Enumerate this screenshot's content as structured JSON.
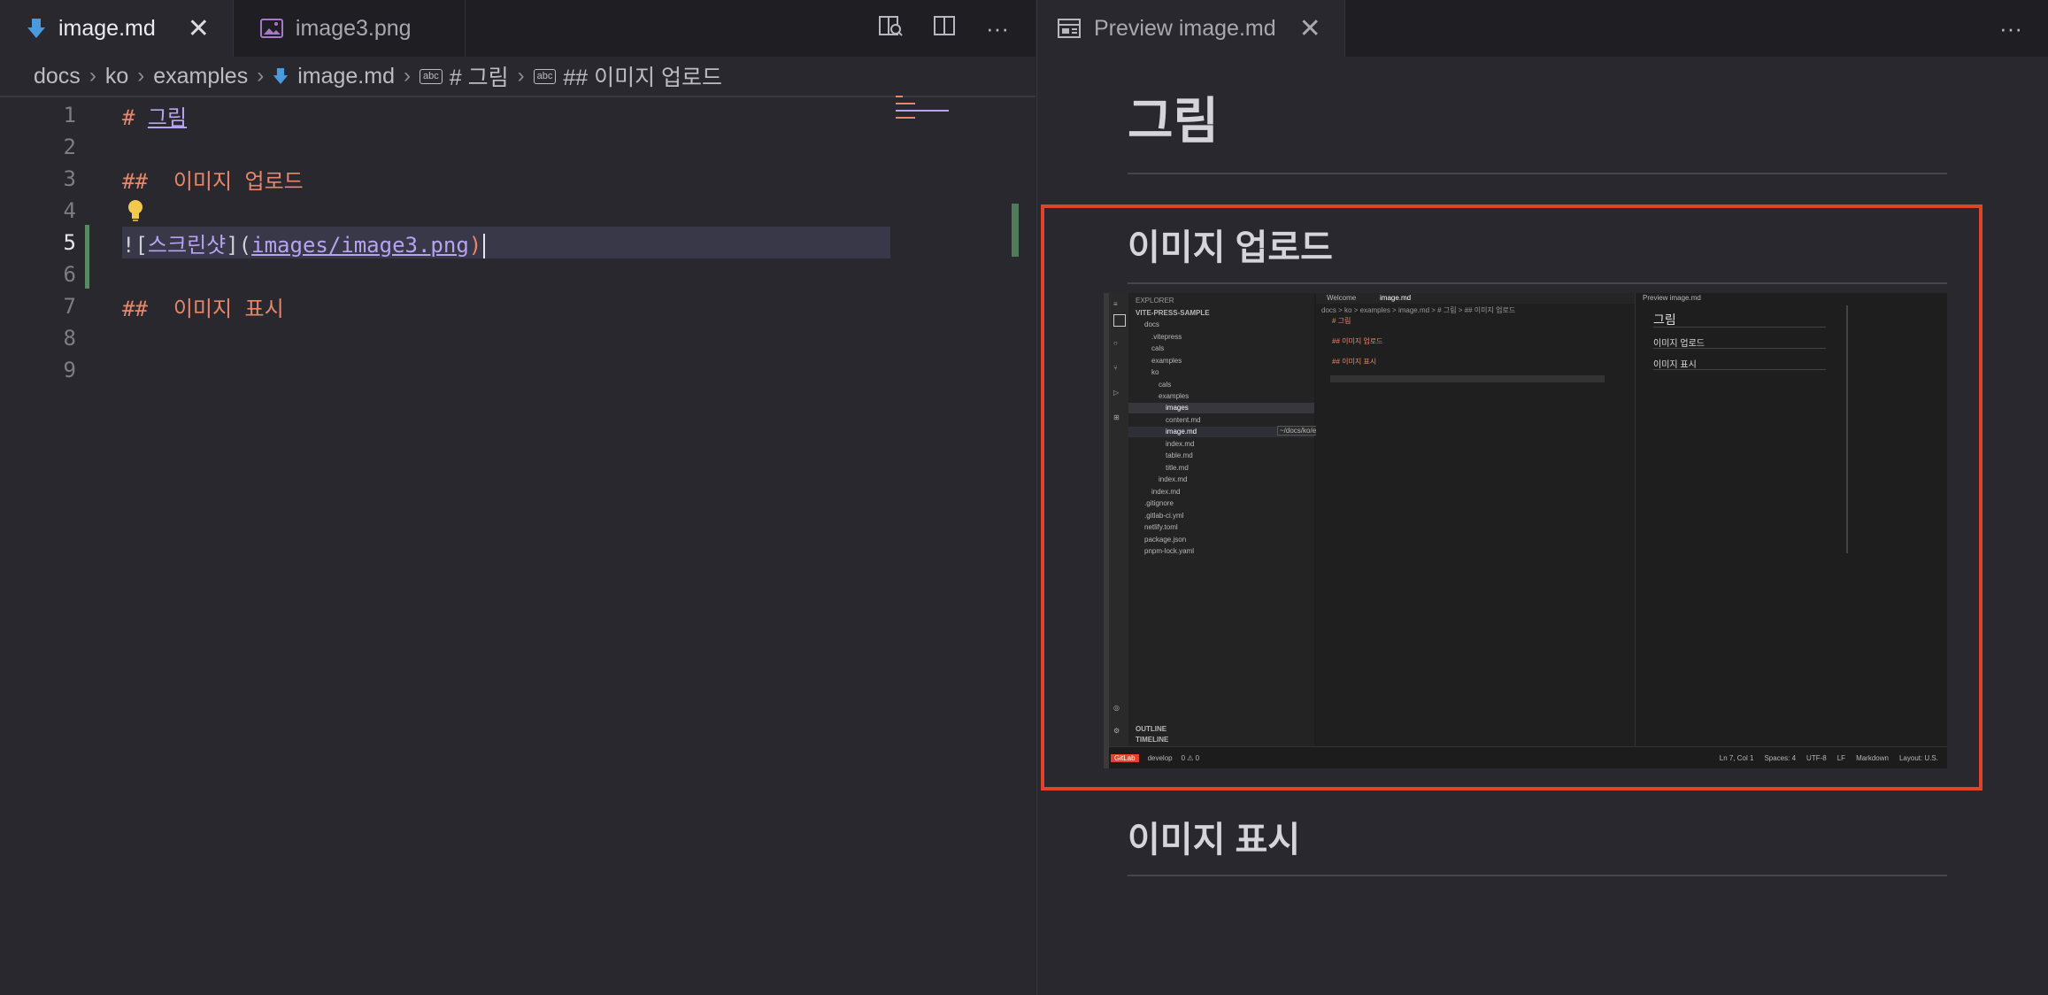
{
  "left_tabs": {
    "tab1_label": "image.md",
    "tab2_label": "image3.png"
  },
  "right_tab": {
    "label": "Preview image.md"
  },
  "breadcrumb": [
    "docs",
    "ko",
    "examples",
    "image.md",
    "# 그림",
    "## 이미지 업로드"
  ],
  "editor": {
    "lines": [
      {
        "n": "1",
        "text": "# 그림"
      },
      {
        "n": "2",
        "text": ""
      },
      {
        "n": "3",
        "text": "## 이미지 업로드"
      },
      {
        "n": "4",
        "text": ""
      },
      {
        "n": "5",
        "text": "![스크린샷](images/image3.png)"
      },
      {
        "n": "6",
        "text": ""
      },
      {
        "n": "7",
        "text": "## 이미지 표시"
      },
      {
        "n": "8",
        "text": ""
      },
      {
        "n": "9",
        "text": ""
      }
    ],
    "heading_hash": "#",
    "h1_text": "그림",
    "h2_hash": "##",
    "h2a_text": "이미지 업로드",
    "h2b_text": "이미지 표시",
    "img_prefix": "![",
    "img_alt": "스크린샷",
    "img_mid": "](",
    "img_path": "images/image3.png",
    "img_suffix": ")"
  },
  "preview": {
    "h1": "그림",
    "h2a": "이미지 업로드",
    "h2b": "이미지 표시"
  },
  "screenshot": {
    "explorer_title": "EXPLORER",
    "project": "VITE-PRESS-SAMPLE",
    "tree": [
      "docs",
      ".vitepress",
      "cals",
      "examples",
      "ko",
      "cals",
      "examples",
      "images",
      "content.md",
      "image.md",
      "index.md",
      "table.md",
      "title.md",
      "index.md",
      "index.md",
      ".gitignore",
      ".gitlab-ci.yml",
      "netlify.toml",
      "package.json",
      "pnpm-lock.yaml"
    ],
    "tooltip": "~/docs/ko/examples/images",
    "outline": "OUTLINE",
    "timeline": "TIMELINE",
    "tab_welcome": "Welcome",
    "tab_image": "image.md",
    "tab_preview": "Preview image.md",
    "mini_breadcrumb": "docs > ko > examples > image.md > # 그림 > ## 이미지 업로드",
    "mini_lines": [
      "# 그림",
      "",
      "## 이미지 업로드",
      "",
      "## 이미지 표시",
      "",
      ""
    ],
    "mini_preview_h1": "그림",
    "mini_preview_h2a": "이미지 업로드",
    "mini_preview_h2b": "이미지 표시",
    "status_left": [
      "GitLab",
      "develop",
      "0 ⚠ 0"
    ],
    "status_right": [
      "Ln 7, Col 1",
      "Spaces: 4",
      "UTF-8",
      "LF",
      "Markdown",
      "Layout: U.S."
    ]
  },
  "colors": {
    "accent_md": "#4a9ade",
    "heading": "#e8866a",
    "link": "#b7a3f0",
    "red_box": "#e0442a"
  }
}
